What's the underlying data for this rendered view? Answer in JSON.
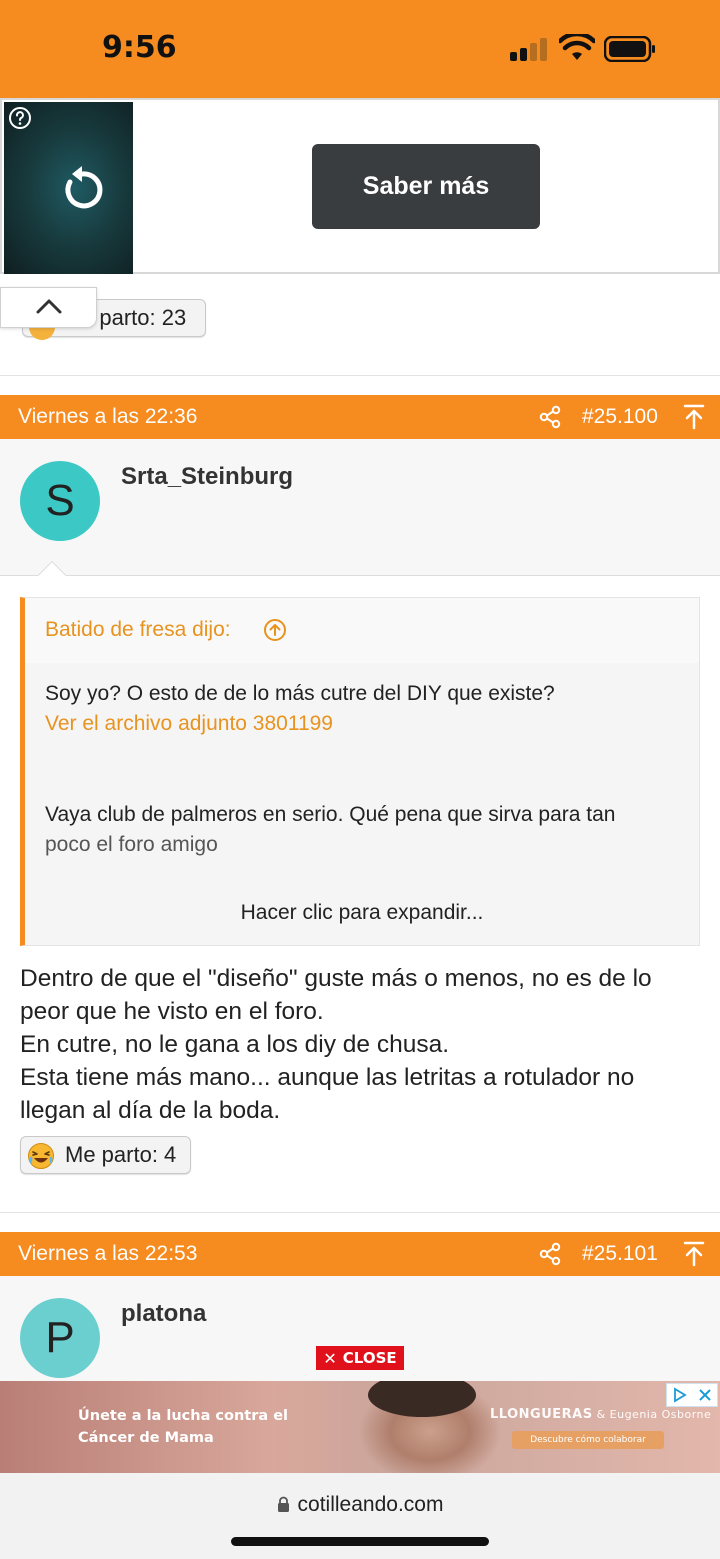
{
  "status": {
    "time": "9:56"
  },
  "top_ad": {
    "cta_label": "Saber más"
  },
  "prev_post": {
    "reaction_label": "Me parto: 23",
    "reaction_visible_label": "e parto: 23"
  },
  "posts": [
    {
      "date": "Viernes a las 22:36",
      "number": "#25.100",
      "username": "Srta_Steinburg",
      "avatar_initial": "S",
      "avatar_color": "#3cc8c4",
      "quote": {
        "author": "Batido de fresa dijo:",
        "line1": "Soy yo? O esto de de lo más cutre del DIY que existe?",
        "attachment_link": "Ver el archivo adjunto 3801199",
        "line2": "Vaya club de palmeros en serio. Qué pena que sirva para tan",
        "line3": "poco el foro amigo",
        "expand_label": "Hacer clic para expandir..."
      },
      "body_lines": [
        "Dentro de que el \"diseño\" guste más o menos, no es de lo",
        "peor que he visto en el foro.",
        "En cutre, no le gana a los diy de chusa.",
        "Esta tiene más mano... aunque las letritas a rotulador no",
        "llegan al día de la boda."
      ],
      "reaction_label": "Me parto: 4"
    },
    {
      "date": "Viernes a las 22:53",
      "number": "#25.101",
      "username": "platona",
      "avatar_initial": "P",
      "avatar_color": "#6ccfcf"
    }
  ],
  "bottom_ad": {
    "close_label": "CLOSE",
    "headline_1": "Únete a la lucha contra el",
    "headline_2": "Cáncer de Mama",
    "brand": "LLONGUERAS",
    "brand_sub": "& Eugenia Osborne",
    "cta": "Descubre cómo colaborar"
  },
  "browser": {
    "url": "cotilleando.com"
  },
  "colors": {
    "accent": "#f68b1f",
    "link": "#e8931f"
  },
  "icons": [
    "signal-icon",
    "wifi-icon",
    "battery-icon",
    "help-icon",
    "replay-icon",
    "chevron-up-icon",
    "share-icon",
    "scroll-top-icon",
    "circle-arrow-up-icon",
    "laughing-emoji-icon",
    "lock-icon",
    "ad-choices-icon",
    "close-x-icon"
  ]
}
